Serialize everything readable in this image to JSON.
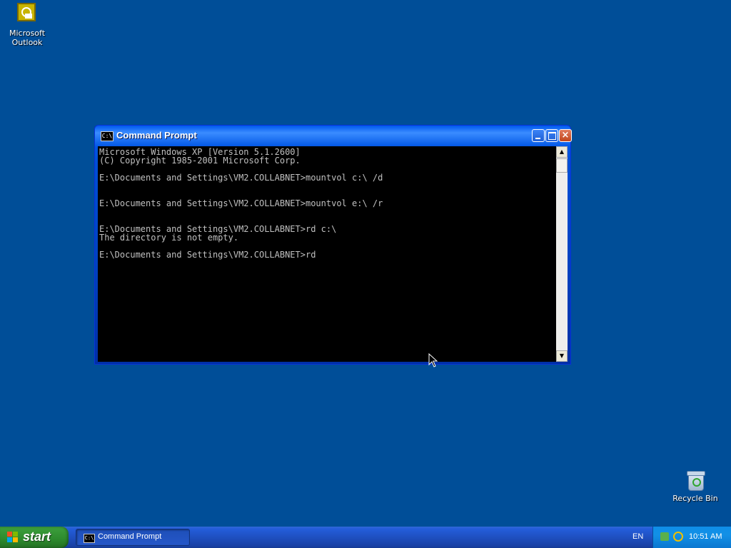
{
  "desktop": {
    "icons": [
      {
        "label": "Microsoft Outlook",
        "icon": "outlook-icon"
      },
      {
        "label": "Recycle Bin",
        "icon": "recycle-bin-icon"
      }
    ]
  },
  "window": {
    "title": "Command Prompt",
    "icon_text": "C:\\",
    "console_lines": [
      "Microsoft Windows XP [Version 5.1.2600]",
      "(C) Copyright 1985-2001 Microsoft Corp.",
      "",
      "E:\\Documents and Settings\\VM2.COLLABNET>mountvol c:\\ /d",
      "",
      "",
      "E:\\Documents and Settings\\VM2.COLLABNET>mountvol e:\\ /r",
      "",
      "",
      "E:\\Documents and Settings\\VM2.COLLABNET>rd c:\\",
      "The directory is not empty.",
      "",
      "E:\\Documents and Settings\\VM2.COLLABNET>rd"
    ],
    "buttons": {
      "minimize": "minimize",
      "maximize": "maximize",
      "close": "×"
    }
  },
  "taskbar": {
    "start_label": "start",
    "tasks": [
      {
        "label": "Command Prompt",
        "icon_text": "C:\\"
      }
    ],
    "language": "EN",
    "clock": "10:51 AM"
  },
  "colors": {
    "desktop": "#004e98",
    "console_bg": "#000000",
    "console_fg": "#c0c0c0"
  }
}
